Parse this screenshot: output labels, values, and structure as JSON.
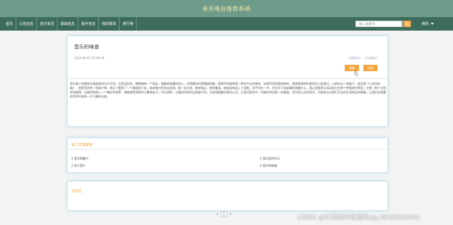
{
  "app": {
    "title": "音乐电台推荐系统"
  },
  "nav": {
    "items": [
      "首页",
      "公告信息",
      "音乐资讯",
      "歌曲信息",
      "歌手信息",
      "我的歌单",
      "排行榜"
    ],
    "search_placeholder": "输入关键词",
    "login_label": "我的"
  },
  "article": {
    "title": "音乐的味道",
    "date": "2023-04-02 15:49:39",
    "stats": [
      "点赞数(1)",
      "评论数(0)"
    ],
    "buttons": [
      "收藏",
      "点赞"
    ],
    "body": "音乐感人的感觉在速度和时与众不同。它是无形的，拥抱着每一个朋友，柔美地慰藉你的心。听得最多的是情感的歌，钢琴声的旋律我一种说不出的感觉，这种声音给我带来的，是透透彻彻的感觉在心底滑过。以前听过一首曲子，曲名是《少女的祈祷》，那是怎样的一首曲子啊，我忘了看到了一个美丽的少女，她穿着白色的连衣裙，像一朵白莲，那样纯洁，那样美丽。她轻轻地闭上了双眼，双手合在一齐，在问光下如安静的祷着什么。我心里被音乐深深吸引在那个梦境的世界里，它是一种十分悦耳的旋律，它能把我带入一个美好的境界，我能感受到那份宁静和安宁。时光流转，当我再次聆听这首曲子时，它依然能触动我的心灵，让我沉醉其中，仿佛时间在那一刻凝固。音乐是心灵的语言，它能表达出我们无法用言语表达的情感，让我们在喧嚣的世界中找到一片宁静的天地。"
  },
  "hot": {
    "title": "热门文章推荐",
    "links": [
      "1 音乐的魅力",
      "2 音乐里的开元",
      "3 关于音乐",
      "4 音乐的味道"
    ]
  },
  "comments": {
    "title": "评论区"
  },
  "pager": {
    "prev": "<",
    "current": "1",
    "next": ">"
  },
  "watermark": "CSDN @计算机毕设源码qq-3836531041"
}
